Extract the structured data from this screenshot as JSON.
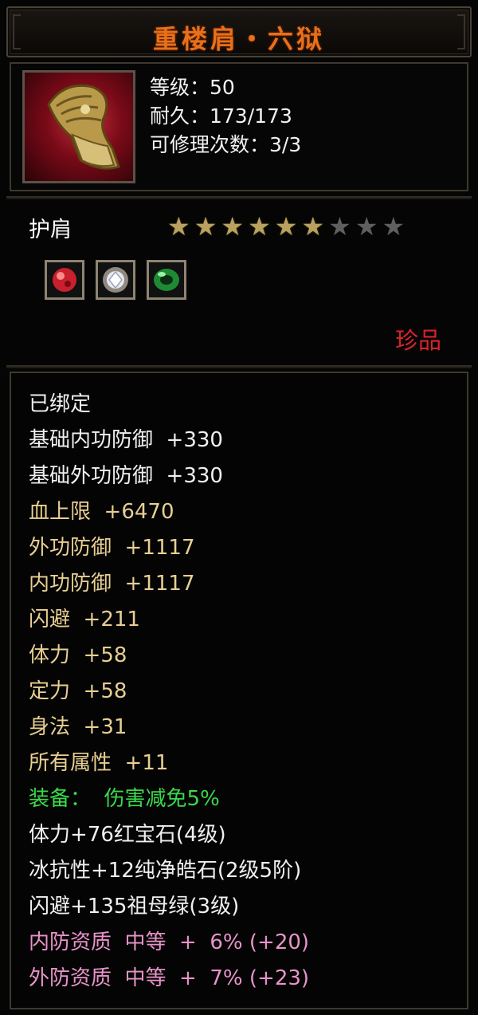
{
  "item": {
    "name": "重楼肩・六狱",
    "level_line": "等级：50",
    "durability_line": "耐久：173/173",
    "repair_line": "可修理次数：3/3",
    "type": "护肩",
    "stars": {
      "filled": 6,
      "total": 9
    },
    "gems": [
      {
        "icon": "ruby-gem-icon",
        "color": "#c8202c"
      },
      {
        "icon": "diamond-gem-icon",
        "color": "#d8d8e0"
      },
      {
        "icon": "emerald-gem-icon",
        "color": "#2fb54a"
      }
    ],
    "rarity": "珍品"
  },
  "stats": [
    {
      "text": "已绑定",
      "color": "white"
    },
    {
      "text": "基础内功防御  +330",
      "color": "white"
    },
    {
      "text": "基础外功防御  +330",
      "color": "white"
    },
    {
      "text": "血上限  +6470",
      "color": "gold"
    },
    {
      "text": "外功防御  +1117",
      "color": "gold"
    },
    {
      "text": "内功防御  +1117",
      "color": "gold"
    },
    {
      "text": "闪避  +211",
      "color": "gold"
    },
    {
      "text": "体力  +58",
      "color": "gold"
    },
    {
      "text": "定力  +58",
      "color": "gold"
    },
    {
      "text": "身法  +31",
      "color": "gold"
    },
    {
      "text": "所有属性  +11",
      "color": "gold"
    },
    {
      "text": "装备：  伤害减免5%",
      "color": "green"
    },
    {
      "text": "体力+76红宝石(4级)",
      "color": "white"
    },
    {
      "text": "冰抗性+12纯净皓石(2级5阶)",
      "color": "white"
    },
    {
      "text": "闪避+135祖母绿(3级)",
      "color": "white"
    },
    {
      "text": "内防资质  中等  +  6% (+20)",
      "color": "pink"
    },
    {
      "text": "外防资质  中等  +  7% (+23)",
      "color": "pink"
    }
  ],
  "colors": {
    "title": "#e8701a",
    "rarity": "#d8232a",
    "gold_text": "#e8cf92",
    "green_text": "#38d94a",
    "pink_text": "#e893c9"
  }
}
